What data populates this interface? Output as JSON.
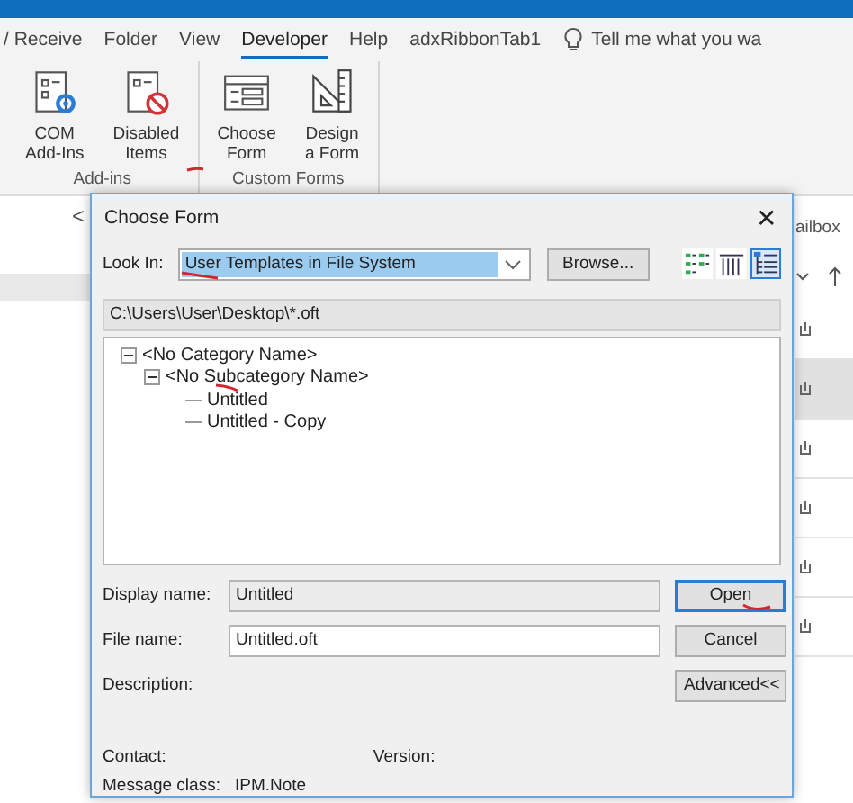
{
  "ribbon": {
    "tabs": [
      {
        "label": "/ Receive",
        "selected": false
      },
      {
        "label": "Folder",
        "selected": false
      },
      {
        "label": "View",
        "selected": false
      },
      {
        "label": "Developer",
        "selected": true
      },
      {
        "label": "Help",
        "selected": false
      },
      {
        "label": "adxRibbonTab1",
        "selected": false
      }
    ],
    "tell_me": "Tell me what you wa",
    "groups": [
      {
        "label": "Add-ins",
        "buttons": [
          {
            "lines": [
              "COM",
              "Add-Ins"
            ]
          },
          {
            "lines": [
              "Disabled",
              "Items"
            ]
          }
        ]
      },
      {
        "label": "Custom Forms",
        "buttons": [
          {
            "lines": [
              "Choose",
              "Form"
            ]
          },
          {
            "lines": [
              "Design",
              "a Form"
            ]
          }
        ]
      }
    ]
  },
  "left_pane": {
    "collapse": "<"
  },
  "right_pane": {
    "header": "ailbox",
    "rows": [
      {
        "selected": false
      },
      {
        "selected": true
      },
      {
        "selected": false
      },
      {
        "selected": false
      },
      {
        "selected": false
      },
      {
        "selected": false
      }
    ]
  },
  "dialog": {
    "title": "Choose Form",
    "close": "✕",
    "look_in": {
      "label": "Look In:",
      "value": "User Templates in File System"
    },
    "browse": "Browse...",
    "views": [
      {
        "selected": false
      },
      {
        "selected": false
      },
      {
        "selected": true
      }
    ],
    "path": "C:\\Users\\User\\Desktop\\*.oft",
    "tree": [
      {
        "label": "<No Category Name>",
        "expanded": true,
        "children": [
          {
            "label": "<No Subcategory Name>",
            "expanded": true,
            "children": [
              {
                "label": "Untitled"
              },
              {
                "label": "Untitled - Copy"
              }
            ]
          }
        ]
      }
    ],
    "display_name": {
      "label": "Display name:",
      "value": "Untitled"
    },
    "file_name": {
      "label": "File name:",
      "value": "Untitled.oft"
    },
    "buttons": [
      {
        "label": "Open",
        "default": true
      },
      {
        "label": "Cancel",
        "default": false
      },
      {
        "label": "Advanced<<",
        "default": false
      }
    ],
    "description": {
      "label": "Description:"
    },
    "contact": {
      "label": "Contact:"
    },
    "version": {
      "label": "Version:"
    },
    "message_class": {
      "label": "Message class:",
      "value": "IPM.Note"
    }
  }
}
